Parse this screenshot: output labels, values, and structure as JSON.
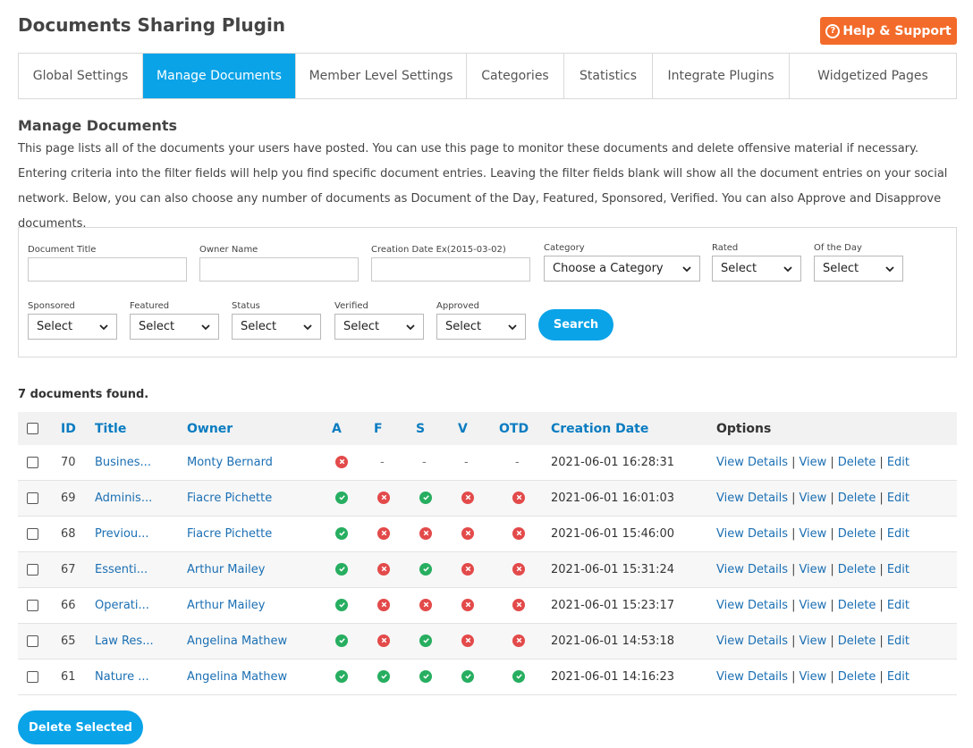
{
  "page_title": "Documents Sharing Plugin",
  "help_button": "Help & Support",
  "tabs": [
    {
      "label": "Global Settings"
    },
    {
      "label": "Manage Documents"
    },
    {
      "label": "Member Level Settings"
    },
    {
      "label": "Categories"
    },
    {
      "label": "Statistics"
    },
    {
      "label": "Integrate Plugins"
    },
    {
      "label": "Widgetized Pages"
    }
  ],
  "section": {
    "title": "Manage Documents",
    "description": "This page lists all of the documents your users have posted. You can use this page to monitor these documents and delete offensive material if necessary. Entering criteria into the filter fields will help you find specific document entries. Leaving the filter fields blank will show all the document entries on your social network. Below, you can also choose any number of documents as Document of the Day, Featured, Sponsored, Verified. You can also Approve and Disapprove documents."
  },
  "filters": {
    "document_title": {
      "label": "Document Title",
      "value": ""
    },
    "owner_name": {
      "label": "Owner Name",
      "value": ""
    },
    "creation_date": {
      "label": "Creation Date Ex(2015-03-02)",
      "value": ""
    },
    "category": {
      "label": "Category",
      "value": "Choose a Category"
    },
    "rated": {
      "label": "Rated",
      "value": "Select"
    },
    "of_the_day": {
      "label": "Of the Day",
      "value": "Select"
    },
    "sponsored": {
      "label": "Sponsored",
      "value": "Select"
    },
    "featured": {
      "label": "Featured",
      "value": "Select"
    },
    "status": {
      "label": "Status",
      "value": "Select"
    },
    "verified": {
      "label": "Verified",
      "value": "Select"
    },
    "approved": {
      "label": "Approved",
      "value": "Select"
    },
    "search_button": "Search"
  },
  "results_count": "7 documents found.",
  "table": {
    "headers": {
      "id": "ID",
      "title": "Title",
      "owner": "Owner",
      "a": "A",
      "f": "F",
      "s": "S",
      "v": "V",
      "otd": "OTD",
      "date": "Creation Date",
      "options": "Options"
    },
    "options": {
      "view_details": "View Details",
      "view": "View",
      "delete": "Delete",
      "edit": "Edit",
      "separator": "|"
    },
    "rows": [
      {
        "id": "70",
        "title": "Busines...",
        "owner": "Monty Bernard",
        "a": "no",
        "f": "-",
        "s": "-",
        "v": "-",
        "otd": "-",
        "date": "2021-06-01 16:28:31"
      },
      {
        "id": "69",
        "title": "Adminis...",
        "owner": "Fiacre Pichette",
        "a": "ok",
        "f": "no",
        "s": "ok",
        "v": "no",
        "otd": "no",
        "date": "2021-06-01 16:01:03"
      },
      {
        "id": "68",
        "title": "Previou...",
        "owner": "Fiacre Pichette",
        "a": "ok",
        "f": "no",
        "s": "no",
        "v": "no",
        "otd": "no",
        "date": "2021-06-01 15:46:00"
      },
      {
        "id": "67",
        "title": "Essenti...",
        "owner": "Arthur Mailey",
        "a": "ok",
        "f": "no",
        "s": "ok",
        "v": "no",
        "otd": "no",
        "date": "2021-06-01 15:31:24"
      },
      {
        "id": "66",
        "title": "Operati...",
        "owner": "Arthur Mailey",
        "a": "ok",
        "f": "no",
        "s": "no",
        "v": "no",
        "otd": "no",
        "date": "2021-06-01 15:23:17"
      },
      {
        "id": "65",
        "title": "Law Res...",
        "owner": "Angelina Mathew",
        "a": "ok",
        "f": "no",
        "s": "ok",
        "v": "no",
        "otd": "no",
        "date": "2021-06-01 14:53:18"
      },
      {
        "id": "61",
        "title": "Nature ...",
        "owner": "Angelina Mathew",
        "a": "ok",
        "f": "ok",
        "s": "ok",
        "v": "ok",
        "otd": "ok",
        "date": "2021-06-01 14:16:23"
      }
    ]
  },
  "delete_selected_button": "Delete Selected",
  "colors": {
    "accent": "#0aa3e8",
    "help": "#f36b2a",
    "ok": "#27ae60",
    "no": "#e34a4a",
    "link": "#1b6fb3"
  }
}
